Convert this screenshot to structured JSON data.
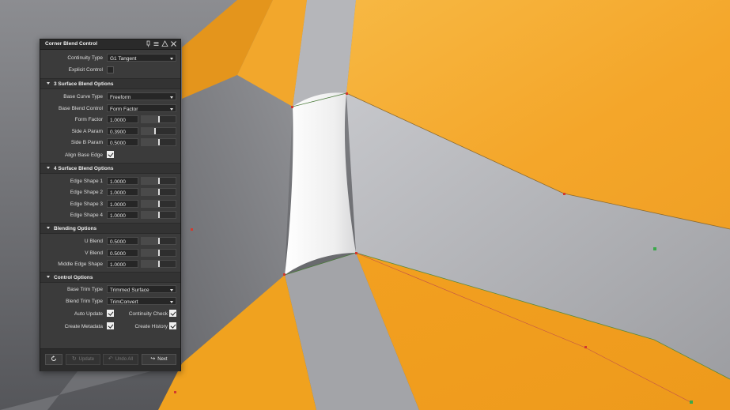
{
  "panel": {
    "title": "Corner Blend Control",
    "title_icons": [
      "pin-icon",
      "menu-icon",
      "warning-icon",
      "close-icon"
    ],
    "continuity_type": {
      "label": "Continuity Type",
      "value": "G1 Tangent"
    },
    "explicit_control": {
      "label": "Explicit Control",
      "checked": false
    },
    "sections": {
      "three_surface": {
        "title": "3 Surface Blend Options",
        "base_curve_type": {
          "label": "Base Curve Type",
          "value": "Freeform"
        },
        "base_blend_control": {
          "label": "Base Blend Control",
          "value": "Form Factor"
        },
        "form_factor": {
          "label": "Form Factor",
          "value": "1.0000",
          "slider": 0.5
        },
        "side_a_param": {
          "label": "Side A Param",
          "value": "0.3900",
          "slider": 0.39
        },
        "side_b_param": {
          "label": "Side B Param",
          "value": "0.5000",
          "slider": 0.5
        },
        "align_base_edge": {
          "label": "Align Base Edge",
          "checked": true
        }
      },
      "four_surface": {
        "title": "4 Surface Blend Options",
        "edge_shape_1": {
          "label": "Edge Shape 1",
          "value": "1.0000",
          "slider": 0.5
        },
        "edge_shape_2": {
          "label": "Edge Shape 2",
          "value": "1.0000",
          "slider": 0.5
        },
        "edge_shape_3": {
          "label": "Edge Shape 3",
          "value": "1.0000",
          "slider": 0.5
        },
        "edge_shape_4": {
          "label": "Edge Shape 4",
          "value": "1.0000",
          "slider": 0.5
        }
      },
      "blending": {
        "title": "Blending Options",
        "u_blend": {
          "label": "U Blend",
          "value": "0.5000",
          "slider": 0.5
        },
        "v_blend": {
          "label": "V Blend",
          "value": "0.5000",
          "slider": 0.5
        },
        "middle_edge_shape": {
          "label": "Middle Edge Shape",
          "value": "1.0000",
          "slider": 0.5
        }
      },
      "control": {
        "title": "Control Options",
        "base_trim_type": {
          "label": "Base Trim Type",
          "value": "Trimmed Surface"
        },
        "blend_trim_type": {
          "label": "Blend Trim Type",
          "value": "TrimConvert"
        },
        "auto_update": {
          "label": "Auto Update",
          "checked": true
        },
        "continuity_check": {
          "label": "Continuity Check",
          "checked": true
        },
        "create_metadata": {
          "label": "Create Metadata",
          "checked": true
        },
        "create_history": {
          "label": "Create History",
          "checked": true
        }
      }
    },
    "footer": {
      "reset_icon": "reset-icon",
      "update": {
        "label": "Update",
        "icon": "refresh-icon",
        "enabled": false
      },
      "undo_all": {
        "label": "Undo All",
        "icon": "undo-icon",
        "enabled": false
      },
      "next": {
        "label": "Next",
        "icon": "next-icon",
        "enabled": true
      }
    }
  },
  "colors": {
    "surface_orange": "#f5a623",
    "surface_gray": "#a9aaae",
    "blend_white": "#f4f4f4",
    "panel_bg": "#3b3b3b",
    "cv_red": "#d23a2e",
    "cv_green": "#3aa84a"
  }
}
